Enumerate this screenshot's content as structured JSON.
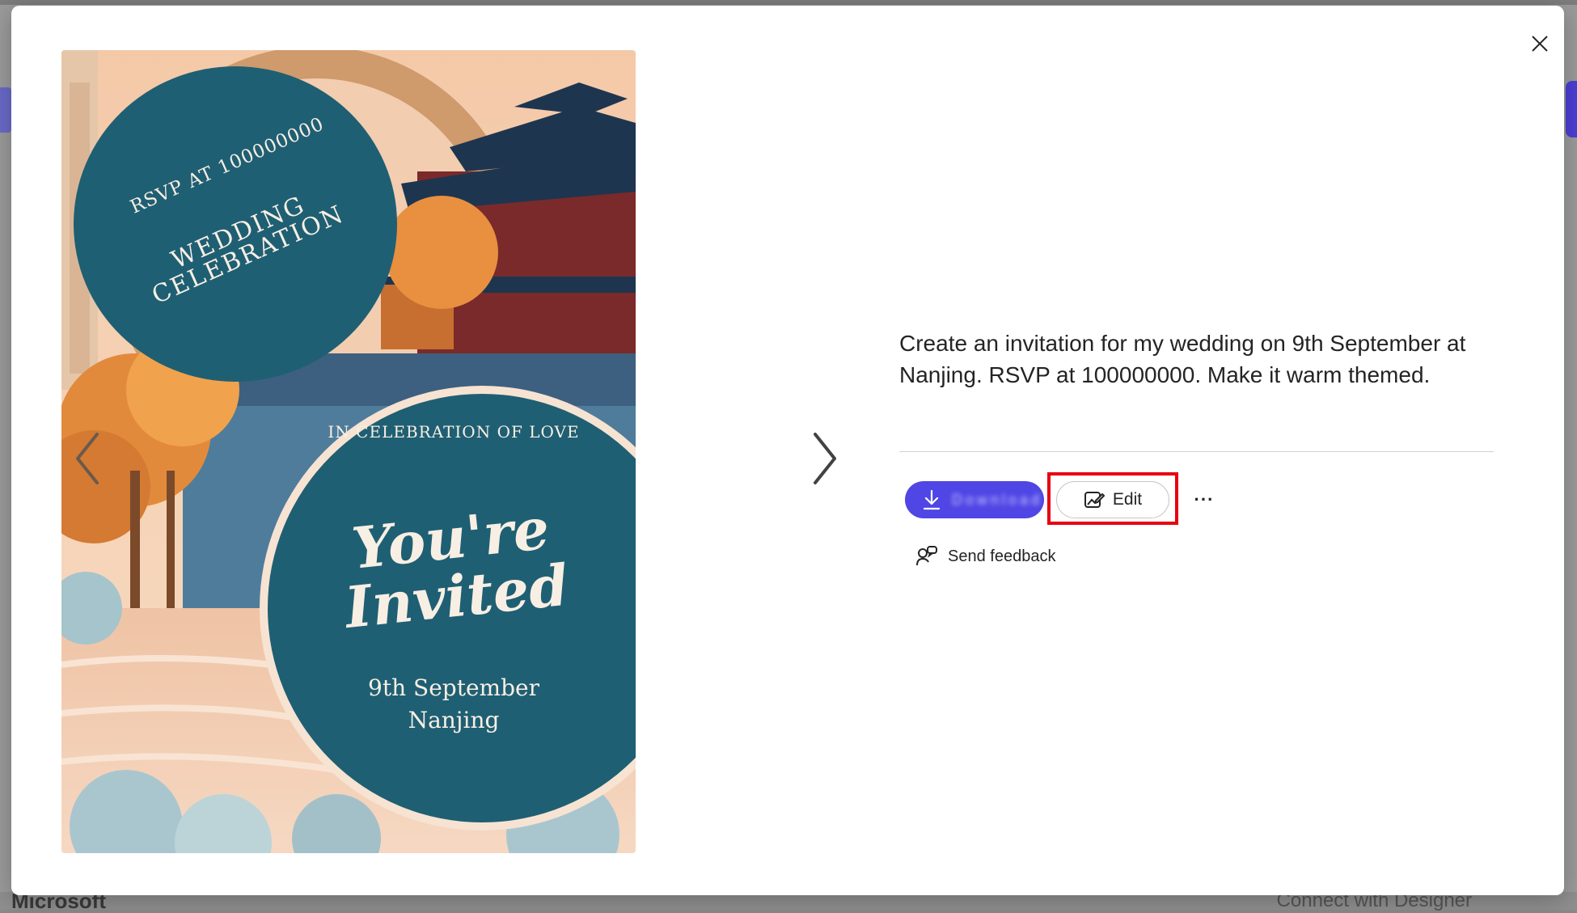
{
  "background": {
    "footer_left": "Microsoft",
    "footer_right": "Connect with Designer"
  },
  "card": {
    "rsvp_text": "RSVP AT 100000000",
    "celebration_text": "WEDDING CELEBRATION",
    "in_celebration_text": "IN CELEBRATION OF LOVE",
    "headline_line1": "You're",
    "headline_line2": "Invited",
    "date_text": "9th September",
    "city_text": "Nanjing"
  },
  "prompt": {
    "text": "Create an invitation for my wedding on 9th September at Nanjing. RSVP at 100000000. Make it warm themed."
  },
  "actions": {
    "download_label": "Download",
    "edit_label": "Edit",
    "more_label": "···",
    "feedback_label": "Send feedback"
  },
  "colors": {
    "accent": "#4f46e5",
    "highlight": "#e60012",
    "card_teal": "#1f5f73"
  }
}
